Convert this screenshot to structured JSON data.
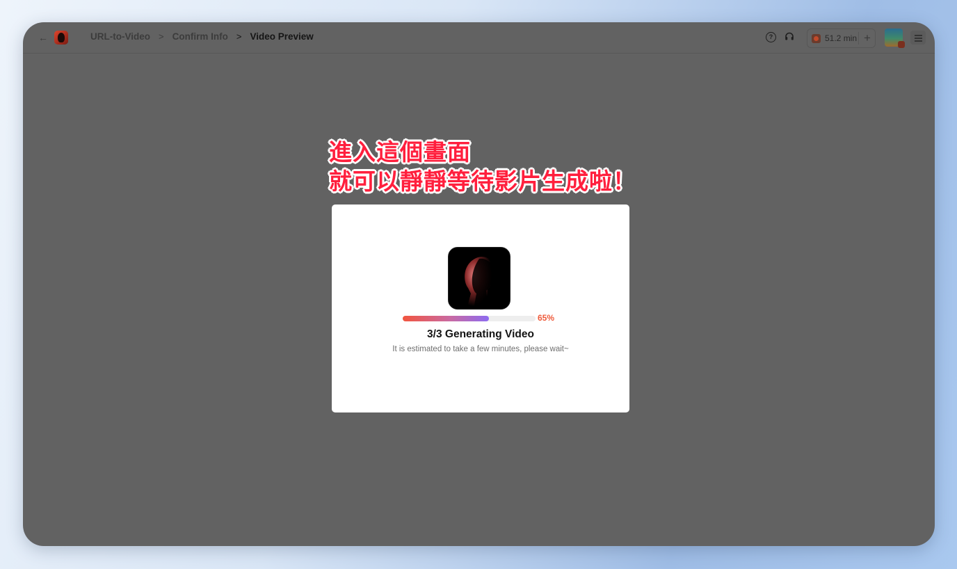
{
  "header": {
    "back_symbol": "←",
    "breadcrumbs": [
      {
        "label": "URL-to-Video"
      },
      {
        "label": "Confirm Info"
      },
      {
        "label": "Video Preview"
      }
    ],
    "sep_symbol": ">",
    "help_symbol": "?",
    "credits": {
      "value": "51.2 min",
      "plus": "+"
    }
  },
  "annotation": {
    "line1": "進入這個畫面",
    "line2": "就可以靜靜等待影片生成啦！"
  },
  "dialog": {
    "progress_percent": 65,
    "progress_label": "65%",
    "status": "3/3 Generating Video",
    "subtitle": "It is estimated to take a few minutes, please wait~"
  },
  "colors": {
    "annotation": "#ff1f3d",
    "percent": "#ef5a3a",
    "overlay": "#626262"
  },
  "icons": [
    "back-arrow-icon",
    "app-logo-icon",
    "chevron-right-icon",
    "help-icon",
    "headset-icon",
    "credit-icon",
    "plus-icon",
    "menu-icon"
  ]
}
